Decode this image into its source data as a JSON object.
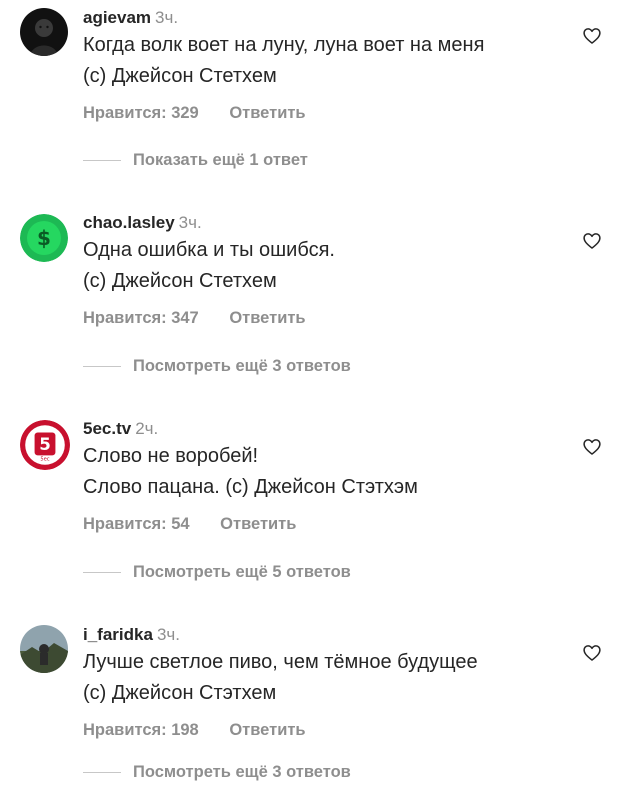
{
  "comments": [
    {
      "username": "agievam",
      "time": "3ч.",
      "line1": "Когда волк воет на луну, луна воет на меня",
      "line2": "(с) Джейсон Стетхем",
      "likes": "Нравится: 329",
      "reply": "Ответить",
      "more": "Показать ещё 1 ответ",
      "avatar_icon": "person-photo-avatar"
    },
    {
      "username": "chao.lasley",
      "time": "3ч.",
      "line1": "Одна ошибка и ты ошибся.",
      "line2": "(с) Джейсон Стетхем",
      "likes": "Нравится: 347",
      "reply": "Ответить",
      "more": "Посмотреть ещё 3 ответов",
      "avatar_icon": "dollar-sign-avatar"
    },
    {
      "username": "5ec.tv",
      "time": "2ч.",
      "line1": "Слово не воробей!",
      "line2": "Слово пацана. (с) Джейсон Стэтхэм",
      "likes": "Нравится: 54",
      "reply": "Ответить",
      "more": "Посмотреть ещё 5 ответов",
      "avatar_icon": "5ec-logo-avatar",
      "avatar_logo_text": "5ec"
    },
    {
      "username": "i_faridka",
      "time": "3ч.",
      "line1": "Лучше светлое пиво, чем тёмное будущее",
      "line2": "(с) Джейсон Стэтхем",
      "likes": "Нравится: 198",
      "reply": "Ответить",
      "more": "Посмотреть ещё 3 ответов",
      "avatar_icon": "landscape-photo-avatar"
    }
  ],
  "colors": {
    "text": "#262626",
    "secondary": "#8e8e8e",
    "divider": "#c7c7c7",
    "dollar_avatar": "#1db954",
    "logo_red": "#c8102e"
  },
  "icons": {
    "like": "heart-outline-icon"
  }
}
